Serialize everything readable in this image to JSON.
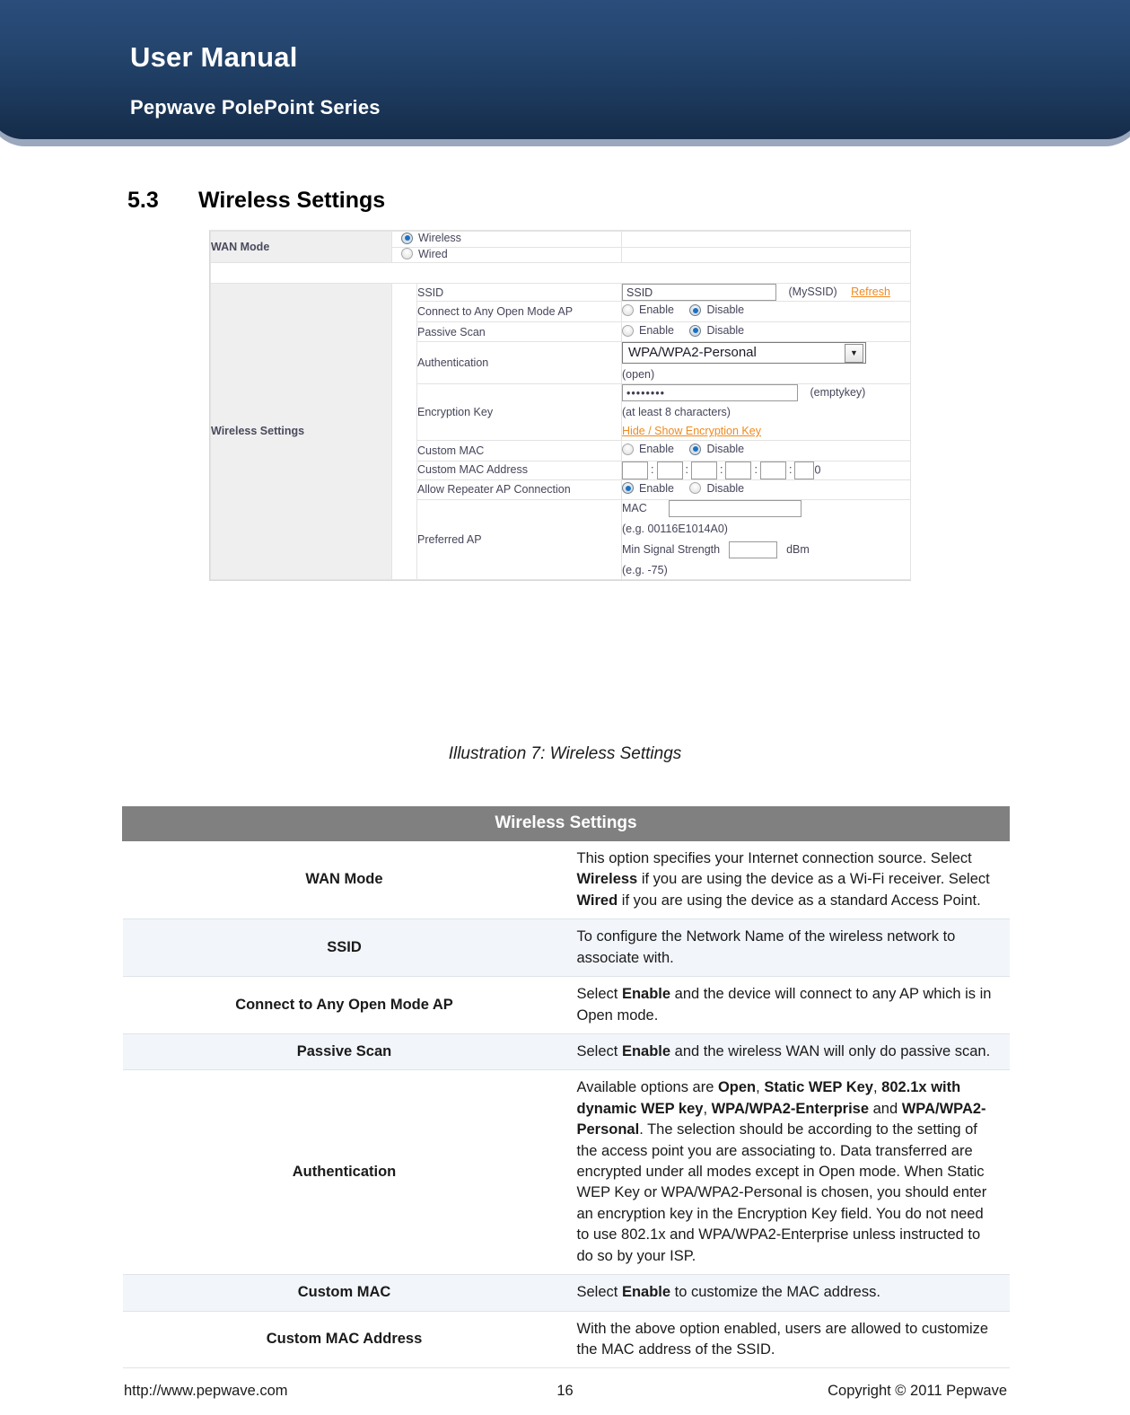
{
  "header": {
    "title": "User Manual",
    "subtitle": "Pepwave PolePoint Series"
  },
  "section": {
    "number": "5.3",
    "title": "Wireless Settings"
  },
  "screenshot": {
    "wan_mode": {
      "label": "WAN Mode",
      "options": [
        {
          "label": "Wireless",
          "selected": true
        },
        {
          "label": "Wired",
          "selected": false
        }
      ]
    },
    "wireless_settings": {
      "label": "Wireless Settings",
      "ssid": {
        "label": "SSID",
        "value": "SSID",
        "note": "(MySSID)",
        "refresh_link": "Refresh"
      },
      "connect_any_open": {
        "label": "Connect to Any Open Mode AP",
        "enable_label": "Enable",
        "disable_label": "Disable",
        "selected": "Disable"
      },
      "passive_scan": {
        "label": "Passive Scan",
        "enable_label": "Enable",
        "disable_label": "Disable",
        "selected": "Disable"
      },
      "authentication": {
        "label": "Authentication",
        "value": "WPA/WPA2-Personal",
        "note": "(open)"
      },
      "encryption_key": {
        "label": "Encryption Key",
        "value": "••••••••",
        "note": "(emptykey)",
        "hint": "(at least 8 characters)",
        "toggle_link": "Hide / Show Encryption Key"
      },
      "custom_mac": {
        "label": "Custom MAC",
        "enable_label": "Enable",
        "disable_label": "Disable",
        "selected": "Disable"
      },
      "custom_mac_address": {
        "label": "Custom MAC Address",
        "octets": [
          "",
          "",
          "",
          "",
          "",
          ""
        ],
        "separator": ":",
        "trailing": "0"
      },
      "allow_repeater": {
        "label": "Allow Repeater AP Connection",
        "enable_label": "Enable",
        "disable_label": "Disable",
        "selected": "Enable"
      },
      "preferred_ap": {
        "label": "Preferred AP",
        "mac_label": "MAC",
        "mac_value": "",
        "mac_example": "(e.g. 00116E1014A0)",
        "min_signal_label": "Min Signal Strength",
        "min_signal_value": "",
        "unit": "dBm",
        "signal_example": "(e.g. -75)"
      }
    }
  },
  "caption": "Illustration 7: Wireless Settings",
  "table": {
    "header": "Wireless Settings",
    "rows": [
      {
        "key": "WAN Mode",
        "parts": [
          {
            "t": "This option specifies your Internet connection source. Select ",
            "b": false
          },
          {
            "t": "Wireless",
            "b": true
          },
          {
            "t": " if you are using the device as a Wi-Fi receiver. Select ",
            "b": false
          },
          {
            "t": "Wired",
            "b": true
          },
          {
            "t": " if you are using the device as a standard Access Point.",
            "b": false
          }
        ]
      },
      {
        "key": "SSID",
        "parts": [
          {
            "t": "To configure the Network Name of the wireless network to associate with.",
            "b": false
          }
        ]
      },
      {
        "key": "Connect to Any Open Mode AP",
        "parts": [
          {
            "t": "Select ",
            "b": false
          },
          {
            "t": "Enable",
            "b": true
          },
          {
            "t": " and the device will connect to any AP which is in Open mode.",
            "b": false
          }
        ]
      },
      {
        "key": "Passive Scan",
        "parts": [
          {
            "t": "Select ",
            "b": false
          },
          {
            "t": "Enable",
            "b": true
          },
          {
            "t": " and the wireless WAN will only do passive scan.",
            "b": false
          }
        ]
      },
      {
        "key": "Authentication",
        "parts": [
          {
            "t": "Available options are ",
            "b": false
          },
          {
            "t": "Open",
            "b": true
          },
          {
            "t": ", ",
            "b": false
          },
          {
            "t": "Static WEP Key",
            "b": true
          },
          {
            "t": ", ",
            "b": false
          },
          {
            "t": "802.1x with dynamic WEP key",
            "b": true
          },
          {
            "t": ", ",
            "b": false
          },
          {
            "t": "WPA/WPA2-Enterprise",
            "b": true
          },
          {
            "t": " and ",
            "b": false
          },
          {
            "t": "WPA/WPA2-Personal",
            "b": true
          },
          {
            "t": ". The selection should be according to the setting of the access point you are associating to.  Data transferred are encrypted under all modes except in Open mode.  When Static WEP Key or WPA/WPA2-Personal is chosen, you should enter an encryption key in the Encryption Key field.  You do not need to use 802.1x and WPA/WPA2-Enterprise unless instructed to do so by your ISP.",
            "b": false
          }
        ]
      },
      {
        "key": "Custom MAC",
        "parts": [
          {
            "t": "Select ",
            "b": false
          },
          {
            "t": "Enable",
            "b": true
          },
          {
            "t": " to customize the MAC address.",
            "b": false
          }
        ]
      },
      {
        "key": "Custom MAC Address",
        "parts": [
          {
            "t": "With the above option enabled, users are allowed to customize the MAC address of the SSID.",
            "b": false
          }
        ]
      }
    ]
  },
  "footer": {
    "url": "http://www.pepwave.com",
    "page": "16",
    "copyright": "Copyright © 2011 Pepwave"
  }
}
